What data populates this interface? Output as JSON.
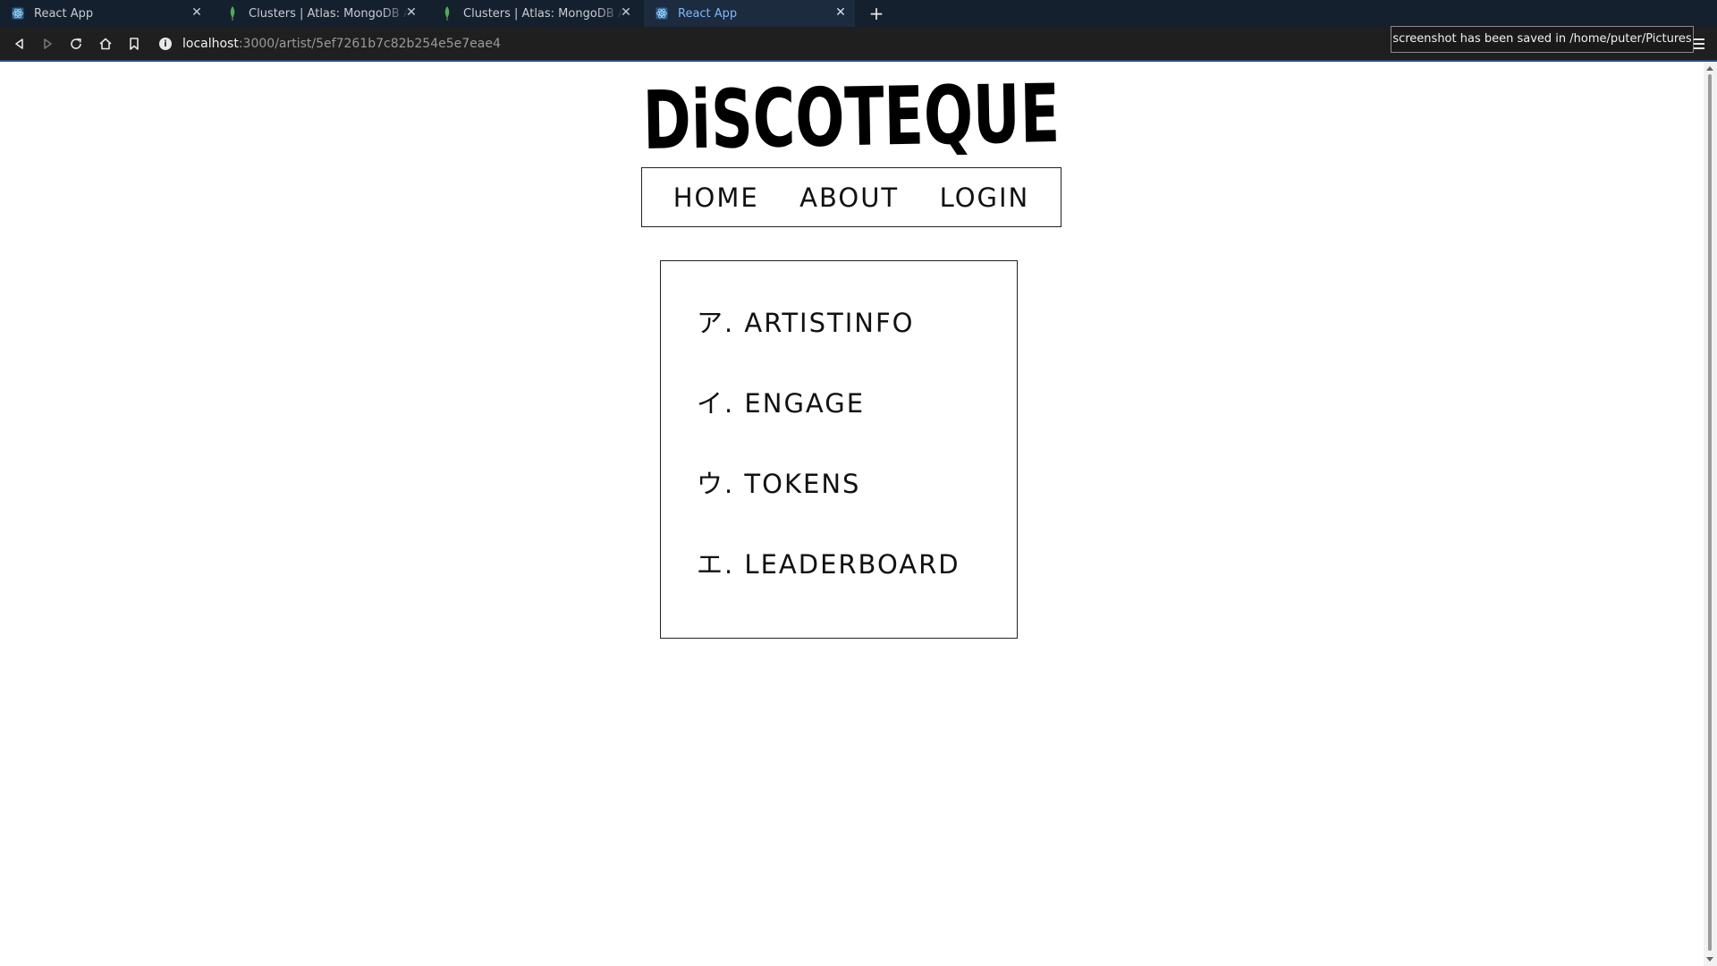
{
  "browser": {
    "tabs": [
      {
        "title": "React App",
        "favicon": "react-icon",
        "active": false
      },
      {
        "title": "Clusters | Atlas: MongoDB Atlas",
        "favicon": "mongodb-leaf-icon",
        "active": false
      },
      {
        "title": "Clusters | Atlas: MongoDB Atlas",
        "favicon": "mongodb-leaf-icon",
        "active": false
      },
      {
        "title": "React App",
        "favicon": "react-icon",
        "active": true
      }
    ],
    "new_tab_label": "+",
    "url_host": "localhost",
    "url_path": ":3000/artist/5ef7261b7c82b254e5e7eae4",
    "toast": "screenshot has been saved in /home/puter/Pictures",
    "accent_color": "#7fb6ff"
  },
  "site": {
    "logo_text": "DiSCOTEQUE",
    "nav": {
      "home": "HOME",
      "about": "ABOUT",
      "login": "LOGIN"
    },
    "menu": [
      {
        "label": "ア. ARTISTINFO"
      },
      {
        "label": "イ. ENGAGE"
      },
      {
        "label": "ウ. TOKENS"
      },
      {
        "label": "エ. LEADERBOARD"
      }
    ]
  }
}
